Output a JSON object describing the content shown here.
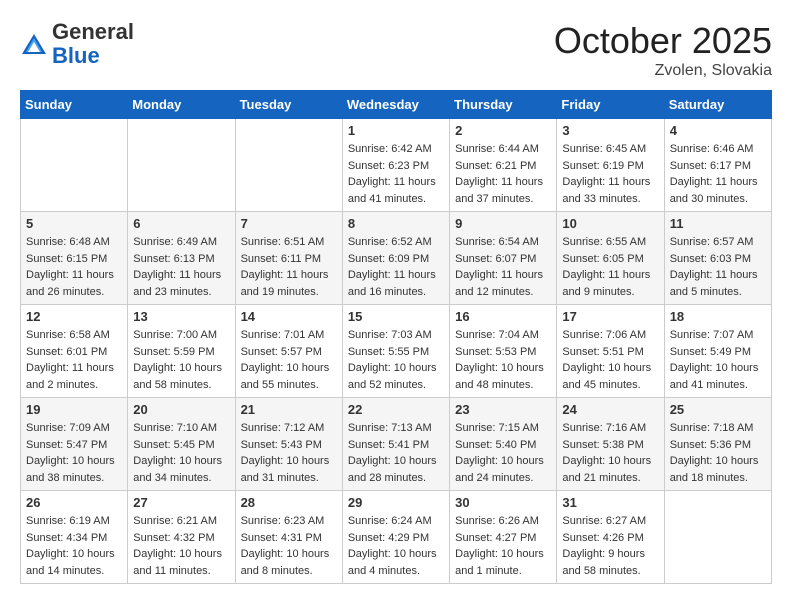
{
  "header": {
    "logo_general": "General",
    "logo_blue": "Blue",
    "month_title": "October 2025",
    "location": "Zvolen, Slovakia"
  },
  "days_of_week": [
    "Sunday",
    "Monday",
    "Tuesday",
    "Wednesday",
    "Thursday",
    "Friday",
    "Saturday"
  ],
  "weeks": [
    [
      {
        "num": "",
        "info": ""
      },
      {
        "num": "",
        "info": ""
      },
      {
        "num": "",
        "info": ""
      },
      {
        "num": "1",
        "info": "Sunrise: 6:42 AM\nSunset: 6:23 PM\nDaylight: 11 hours and 41 minutes."
      },
      {
        "num": "2",
        "info": "Sunrise: 6:44 AM\nSunset: 6:21 PM\nDaylight: 11 hours and 37 minutes."
      },
      {
        "num": "3",
        "info": "Sunrise: 6:45 AM\nSunset: 6:19 PM\nDaylight: 11 hours and 33 minutes."
      },
      {
        "num": "4",
        "info": "Sunrise: 6:46 AM\nSunset: 6:17 PM\nDaylight: 11 hours and 30 minutes."
      }
    ],
    [
      {
        "num": "5",
        "info": "Sunrise: 6:48 AM\nSunset: 6:15 PM\nDaylight: 11 hours and 26 minutes."
      },
      {
        "num": "6",
        "info": "Sunrise: 6:49 AM\nSunset: 6:13 PM\nDaylight: 11 hours and 23 minutes."
      },
      {
        "num": "7",
        "info": "Sunrise: 6:51 AM\nSunset: 6:11 PM\nDaylight: 11 hours and 19 minutes."
      },
      {
        "num": "8",
        "info": "Sunrise: 6:52 AM\nSunset: 6:09 PM\nDaylight: 11 hours and 16 minutes."
      },
      {
        "num": "9",
        "info": "Sunrise: 6:54 AM\nSunset: 6:07 PM\nDaylight: 11 hours and 12 minutes."
      },
      {
        "num": "10",
        "info": "Sunrise: 6:55 AM\nSunset: 6:05 PM\nDaylight: 11 hours and 9 minutes."
      },
      {
        "num": "11",
        "info": "Sunrise: 6:57 AM\nSunset: 6:03 PM\nDaylight: 11 hours and 5 minutes."
      }
    ],
    [
      {
        "num": "12",
        "info": "Sunrise: 6:58 AM\nSunset: 6:01 PM\nDaylight: 11 hours and 2 minutes."
      },
      {
        "num": "13",
        "info": "Sunrise: 7:00 AM\nSunset: 5:59 PM\nDaylight: 10 hours and 58 minutes."
      },
      {
        "num": "14",
        "info": "Sunrise: 7:01 AM\nSunset: 5:57 PM\nDaylight: 10 hours and 55 minutes."
      },
      {
        "num": "15",
        "info": "Sunrise: 7:03 AM\nSunset: 5:55 PM\nDaylight: 10 hours and 52 minutes."
      },
      {
        "num": "16",
        "info": "Sunrise: 7:04 AM\nSunset: 5:53 PM\nDaylight: 10 hours and 48 minutes."
      },
      {
        "num": "17",
        "info": "Sunrise: 7:06 AM\nSunset: 5:51 PM\nDaylight: 10 hours and 45 minutes."
      },
      {
        "num": "18",
        "info": "Sunrise: 7:07 AM\nSunset: 5:49 PM\nDaylight: 10 hours and 41 minutes."
      }
    ],
    [
      {
        "num": "19",
        "info": "Sunrise: 7:09 AM\nSunset: 5:47 PM\nDaylight: 10 hours and 38 minutes."
      },
      {
        "num": "20",
        "info": "Sunrise: 7:10 AM\nSunset: 5:45 PM\nDaylight: 10 hours and 34 minutes."
      },
      {
        "num": "21",
        "info": "Sunrise: 7:12 AM\nSunset: 5:43 PM\nDaylight: 10 hours and 31 minutes."
      },
      {
        "num": "22",
        "info": "Sunrise: 7:13 AM\nSunset: 5:41 PM\nDaylight: 10 hours and 28 minutes."
      },
      {
        "num": "23",
        "info": "Sunrise: 7:15 AM\nSunset: 5:40 PM\nDaylight: 10 hours and 24 minutes."
      },
      {
        "num": "24",
        "info": "Sunrise: 7:16 AM\nSunset: 5:38 PM\nDaylight: 10 hours and 21 minutes."
      },
      {
        "num": "25",
        "info": "Sunrise: 7:18 AM\nSunset: 5:36 PM\nDaylight: 10 hours and 18 minutes."
      }
    ],
    [
      {
        "num": "26",
        "info": "Sunrise: 6:19 AM\nSunset: 4:34 PM\nDaylight: 10 hours and 14 minutes."
      },
      {
        "num": "27",
        "info": "Sunrise: 6:21 AM\nSunset: 4:32 PM\nDaylight: 10 hours and 11 minutes."
      },
      {
        "num": "28",
        "info": "Sunrise: 6:23 AM\nSunset: 4:31 PM\nDaylight: 10 hours and 8 minutes."
      },
      {
        "num": "29",
        "info": "Sunrise: 6:24 AM\nSunset: 4:29 PM\nDaylight: 10 hours and 4 minutes."
      },
      {
        "num": "30",
        "info": "Sunrise: 6:26 AM\nSunset: 4:27 PM\nDaylight: 10 hours and 1 minute."
      },
      {
        "num": "31",
        "info": "Sunrise: 6:27 AM\nSunset: 4:26 PM\nDaylight: 9 hours and 58 minutes."
      },
      {
        "num": "",
        "info": ""
      }
    ]
  ]
}
